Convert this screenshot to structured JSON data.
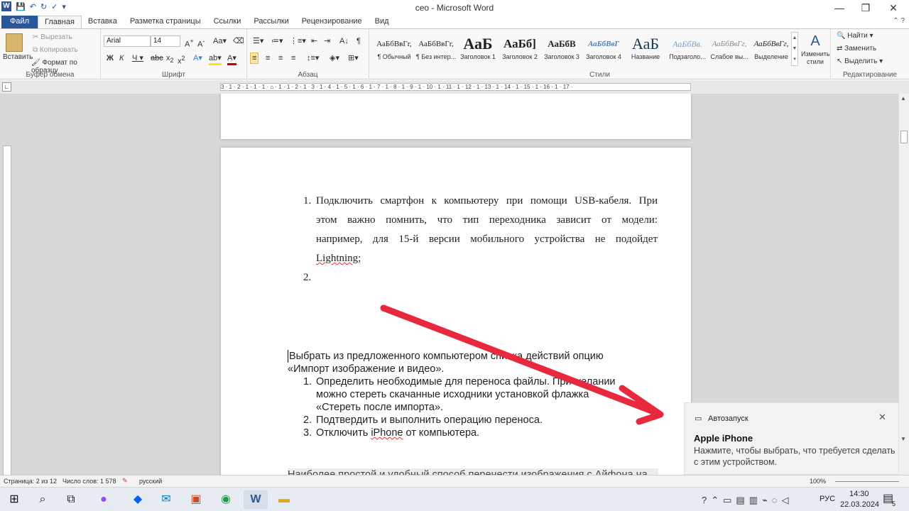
{
  "window": {
    "title": "ceo - Microsoft Word",
    "minimize": "—",
    "restore": "❐",
    "close": "✕"
  },
  "tabs": [
    "Файл",
    "Главная",
    "Вставка",
    "Разметка страницы",
    "Ссылки",
    "Рассылки",
    "Рецензирование",
    "Вид"
  ],
  "ribbon": {
    "clipboard": {
      "label": "Буфер обмена",
      "paste": "Вставить",
      "cut": "Вырезать",
      "copy": "Копировать",
      "format_painter": "Формат по образцу"
    },
    "font": {
      "label": "Шрифт",
      "family": "Arial",
      "size": "14"
    },
    "paragraph": {
      "label": "Абзац"
    },
    "styles": {
      "label": "Стили",
      "items": [
        {
          "preview": "АаБбВвГг,",
          "name": "¶ Обычный"
        },
        {
          "preview": "АаБбВвГг,",
          "name": "¶ Без интер..."
        },
        {
          "preview": "АаБ",
          "name": "Заголовок 1"
        },
        {
          "preview": "АаБб]",
          "name": "Заголовок 2"
        },
        {
          "preview": "АаБбВ",
          "name": "Заголовок 3"
        },
        {
          "preview": "АаБбВвГ",
          "name": "Заголовок 4"
        },
        {
          "preview": "АаБ",
          "name": "Название"
        },
        {
          "preview": "АаБбВв.",
          "name": "Подзаголо..."
        },
        {
          "preview": "АаБбВвГг,",
          "name": "Слабое вы..."
        },
        {
          "preview": "АаБбВвГг,",
          "name": "Выделение"
        }
      ],
      "change_styles": "Изменить стили"
    },
    "editing": {
      "label": "Редактирование",
      "find": "Найти",
      "replace": "Заменить",
      "select": "Выделить"
    }
  },
  "ruler_text": "3 · 1 · 2 · 1 · 1 · 1 · ⌂ · 1 · 1 · 2 · 1 · 3 · 1 · 4 · 1 · 5 · 1 · 6 · 1 · 7 · 1 · 8 · 1 · 9 · 1 · 10 · 1 · 11 · 1 · 12 · 1 · 13 · 1 · 14 · 1 · 15 · 1 · 16 · 1 · 17 ·",
  "document": {
    "list1": {
      "item1_num": "1.",
      "item1_lines": [
        "Подключить смартфон к компьютеру при помощи USB-кабеля. При",
        "этом важно помнить, что тип переходника зависит от модели:",
        "например, для 15-й версии мобильного устройства не подойдет"
      ],
      "item1_last_word": "Lightning",
      "item1_last_punct": ";",
      "item2_num": "2."
    },
    "para": {
      "line1": "Выбрать из предложенного компьютером списка действий опцию",
      "line2": "«Импорт изображение и видео»."
    },
    "list2": [
      {
        "num": "1.",
        "lines": [
          "Определить необходимые для переноса файлы. При желании",
          "можно стереть скачанные исходники установкой флажка",
          "«Стереть после импорта»."
        ]
      },
      {
        "num": "2.",
        "lines": [
          "Подтвердить и выполнить операцию переноса."
        ]
      },
      {
        "num": "3.",
        "before": "Отключить ",
        "word": "iPhone",
        "after": " от компьютера."
      }
    ],
    "cut_line": "Наиболее простой и удобный способ перенести изображения с Айфона на"
  },
  "status": {
    "page": "Страница: 2 из 12",
    "words": "Число слов: 1 578",
    "lang": "русский",
    "zoom": "100%"
  },
  "toast": {
    "app": "Автозапуск",
    "title": "Apple iPhone",
    "body_line1": "Нажмите, чтобы выбрать, что требуется сделать",
    "body_line2": "с этим устройством."
  },
  "taskbar": {
    "lang": "РУС",
    "time": "14:30",
    "date": "22.03.2024",
    "notif_count": "5"
  },
  "colors": {
    "accent": "#2b579a",
    "arrow": "#e8283c"
  }
}
